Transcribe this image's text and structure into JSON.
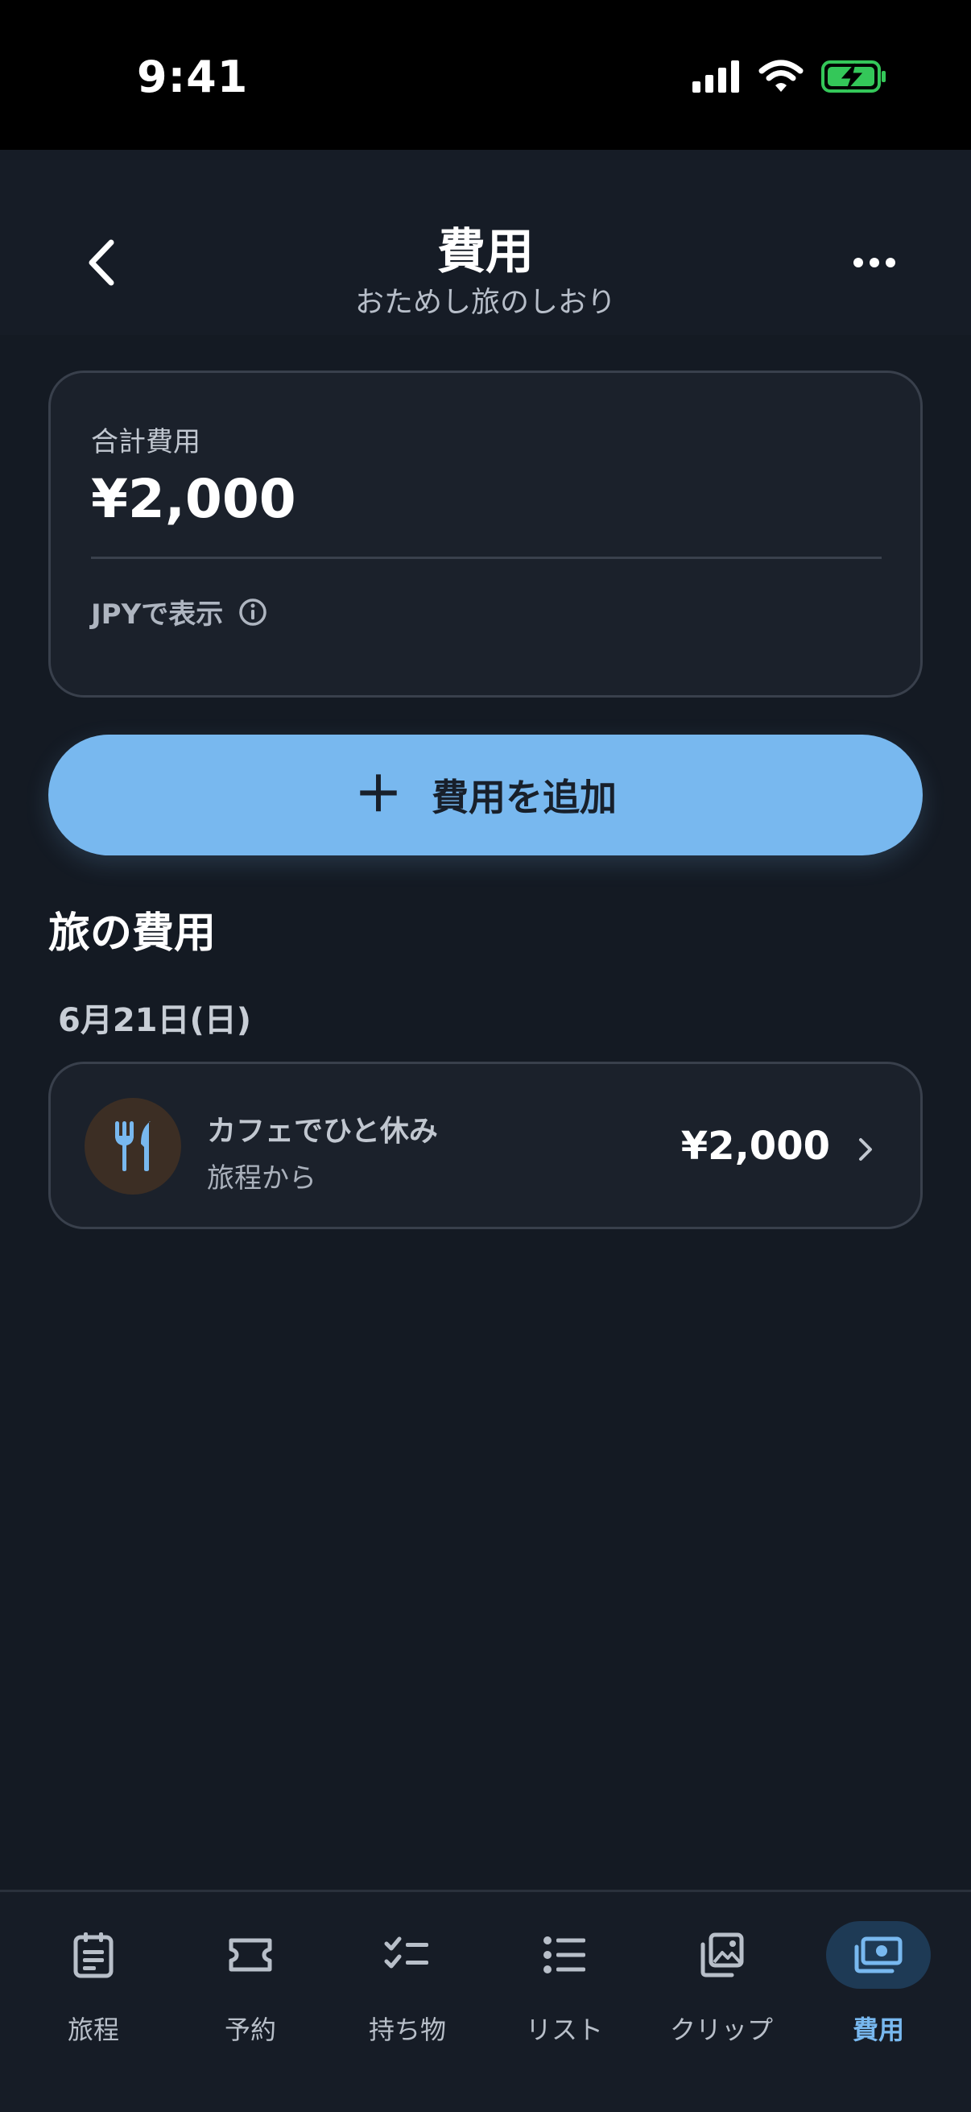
{
  "status_bar": {
    "time": "9:41"
  },
  "header": {
    "title": "費用",
    "subtitle": "おためし旅のしおり"
  },
  "summary": {
    "label": "合計費用",
    "amount": "¥2,000",
    "currency_label": "JPYで表示"
  },
  "add_button": {
    "plus": "＋",
    "label": "費用を追加"
  },
  "section": {
    "title": "旅の費用",
    "groups": [
      {
        "date": "6月21日(日)",
        "items": [
          {
            "title": "カフェでひと休み",
            "source": "旅程から",
            "amount": "¥2,000",
            "icon": "fork-knife-icon"
          }
        ]
      }
    ]
  },
  "tabbar": {
    "tabs": [
      {
        "label": "旅程",
        "icon": "itinerary-icon"
      },
      {
        "label": "予約",
        "icon": "ticket-icon"
      },
      {
        "label": "持ち物",
        "icon": "checklist-icon"
      },
      {
        "label": "リスト",
        "icon": "list-icon"
      },
      {
        "label": "クリップ",
        "icon": "clip-icon"
      },
      {
        "label": "費用",
        "icon": "money-icon",
        "active": true
      }
    ]
  },
  "colors": {
    "accent": "#78b8ef",
    "background": "#141a23",
    "card": "#1b212b",
    "battery": "#34c759"
  }
}
